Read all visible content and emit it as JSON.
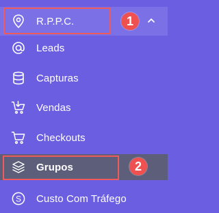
{
  "menu": {
    "header": {
      "label": "R.P.P.C.",
      "expanded": true,
      "icon": "location-pin-icon"
    },
    "items": [
      {
        "label": "Leads",
        "icon": "at-sign-icon"
      },
      {
        "label": "Capturas",
        "icon": "database-icon"
      },
      {
        "label": "Vendas",
        "icon": "cart-download-icon"
      },
      {
        "label": "Checkouts",
        "icon": "shopping-cart-icon"
      },
      {
        "label": "Grupos",
        "icon": "layers-icon",
        "active": true
      },
      {
        "label": "Custo Com Tráfego",
        "icon": "dollar-circle-icon"
      }
    ]
  },
  "annotations": {
    "badge_1": "1",
    "badge_2": "2"
  },
  "colors": {
    "background": "#6b5ee0",
    "header_bg": "#7b70e6",
    "active_bg": "#5c5e7a",
    "highlight": "#ef5b5b",
    "text": "#ffffff"
  }
}
